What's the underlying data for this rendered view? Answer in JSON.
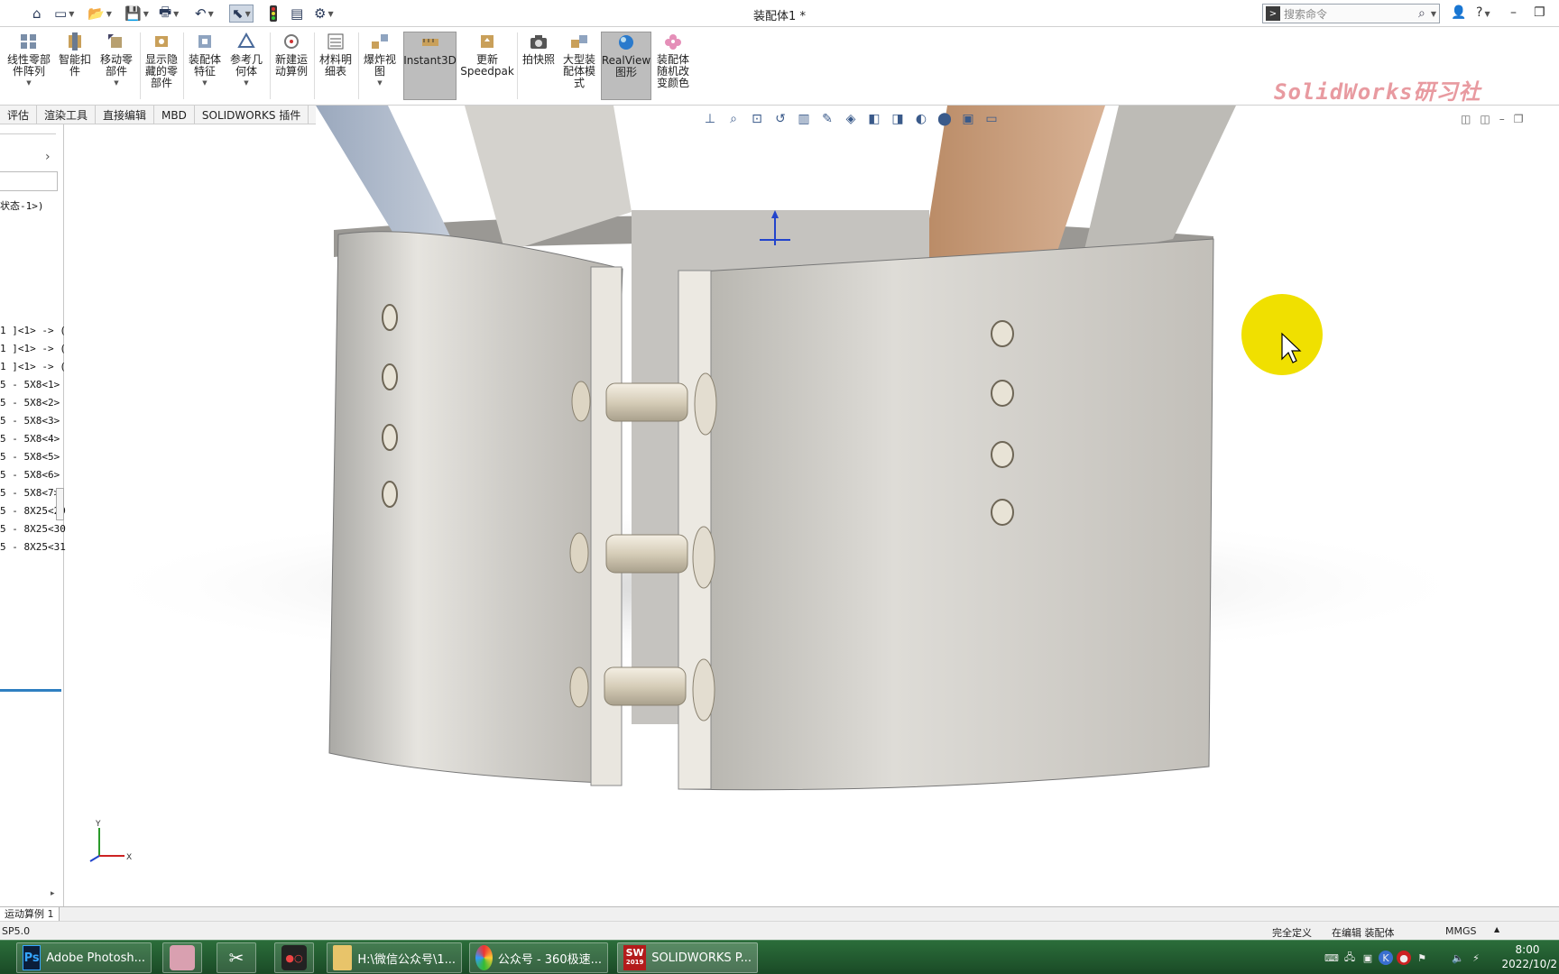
{
  "titlebar": {
    "doc_title": "装配体1 *",
    "search_placeholder": "搜索命令",
    "help_icon": "?"
  },
  "ribbon": {
    "buttons": [
      {
        "label1": "线性零部",
        "label2": "件阵列",
        "label3": ""
      },
      {
        "label1": "智能扣",
        "label2": "件",
        "label3": ""
      },
      {
        "label1": "移动零",
        "label2": "部件",
        "label3": ""
      },
      {
        "label1": "显示隐",
        "label2": "藏的零",
        "label3": "部件"
      },
      {
        "label1": "装配体",
        "label2": "特征",
        "label3": ""
      },
      {
        "label1": "参考几",
        "label2": "何体",
        "label3": ""
      },
      {
        "label1": "新建运",
        "label2": "动算例",
        "label3": ""
      },
      {
        "label1": "材料明",
        "label2": "细表",
        "label3": ""
      },
      {
        "label1": "爆炸视",
        "label2": "图",
        "label3": ""
      },
      {
        "label1": "Instant3D",
        "label2": "",
        "label3": ""
      },
      {
        "label1": "更新",
        "label2": "Speedpak",
        "label3": ""
      },
      {
        "label1": "拍快照",
        "label2": "",
        "label3": ""
      },
      {
        "label1": "大型装",
        "label2": "配体模",
        "label3": "式"
      },
      {
        "label1": "RealView",
        "label2": "图形",
        "label3": ""
      },
      {
        "label1": "装配体",
        "label2": "随机改",
        "label3": "变颜色"
      }
    ],
    "brand": "SolidWorks研习社"
  },
  "tabs": [
    "评估",
    "渲染工具",
    "直接编辑",
    "MBD",
    "SOLIDWORKS 插件"
  ],
  "tree": {
    "config_fragment": "状态-1>)",
    "items": [
      "1 ]<1> -> (",
      "1 ]<1> -> (",
      "1 ]<1> -> (",
      "5 - 5X8<1>",
      "5 - 5X8<2>",
      "5 - 5X8<3>",
      "5 - 5X8<4>",
      "5 - 5X8<5>",
      "5 - 5X8<6>",
      "5 - 5X8<7>",
      "5 - 8X25<29",
      "5 - 8X25<30",
      "5 - 8X25<31"
    ]
  },
  "motion_tab": "运动算例 1",
  "status": {
    "left": "SP5.0",
    "defined": "完全定义",
    "editing": "在编辑 装配体",
    "units": "MMGS"
  },
  "taskbar": {
    "items": [
      {
        "icon_text": "Ps",
        "label": "Adobe Photosh..."
      },
      {
        "icon_text": "",
        "label": ""
      },
      {
        "icon_text": "",
        "label": ""
      },
      {
        "icon_text": "",
        "label": ""
      },
      {
        "icon_text": "",
        "label": "H:\\微信公众号\\1..."
      },
      {
        "icon_text": "",
        "label": "公众号 - 360极速..."
      },
      {
        "icon_text": "SW",
        "label": "SOLIDWORKS P..."
      }
    ],
    "sw_year": "2019",
    "clock_time": "8:00",
    "clock_date": "2022/10/2"
  },
  "axes": {
    "x": "X",
    "y": "Y"
  }
}
